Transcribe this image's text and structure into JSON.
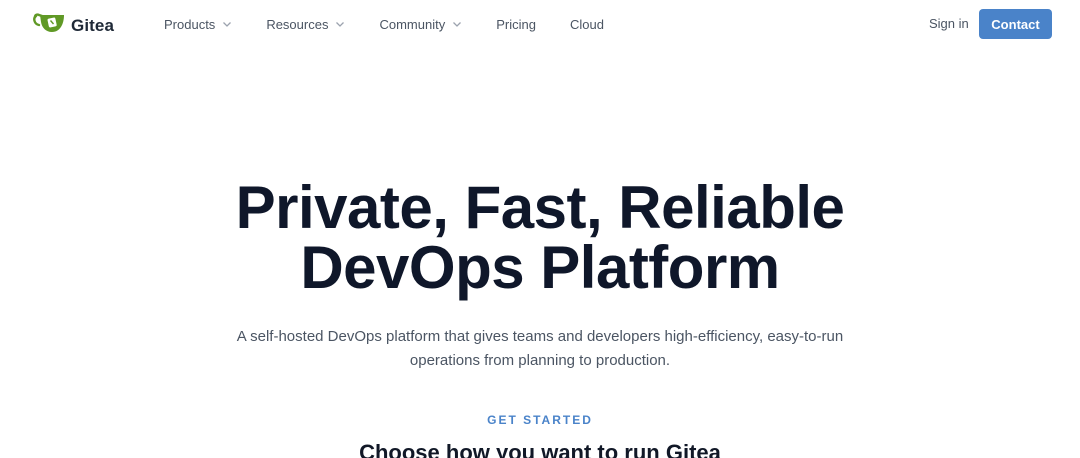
{
  "header": {
    "logo_text": "Gitea",
    "nav": [
      {
        "label": "Products",
        "dropdown": true
      },
      {
        "label": "Resources",
        "dropdown": true
      },
      {
        "label": "Community",
        "dropdown": true
      },
      {
        "label": "Pricing",
        "dropdown": false
      },
      {
        "label": "Cloud",
        "dropdown": false
      }
    ],
    "sign_in": "Sign in",
    "contact": "Contact"
  },
  "hero": {
    "title_line1": "Private, Fast, Reliable",
    "title_line2": "DevOps Platform",
    "subtitle": "A self-hosted DevOps platform that gives teams and developers high-efficiency, easy-to-run operations from planning to production.",
    "eyebrow": "GET STARTED",
    "section_title": "Choose how you want to run Gitea"
  },
  "colors": {
    "brand_green": "#609926",
    "accent_blue": "#4a83c9",
    "heading": "#0f172a",
    "body_text": "#4b5563"
  },
  "icons": {
    "logo": "gitea-teacup-icon",
    "dropdown": "chevron-down-icon"
  }
}
